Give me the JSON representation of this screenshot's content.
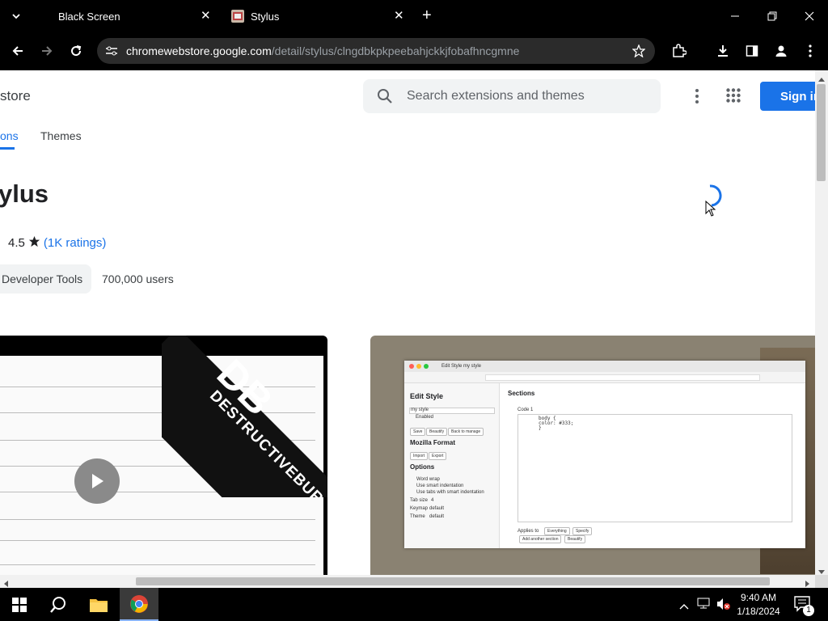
{
  "browser": {
    "tabs": [
      {
        "title": "Black Screen",
        "active": false
      },
      {
        "title": "Stylus",
        "active": true
      }
    ],
    "url_domain": "chromewebstore.google.com",
    "url_path": "/detail/stylus/clngdbkpkpeebahjckkjfobafhncgmne"
  },
  "store": {
    "label": "store",
    "search_placeholder": "Search extensions and themes",
    "sign_in_label": "Sign in",
    "nav_tabs": [
      {
        "label": "ons",
        "active": true
      },
      {
        "label": "Themes",
        "active": false
      }
    ]
  },
  "extension": {
    "title": "ylus",
    "rating": "4.5",
    "ratings_link": "(1K ratings)",
    "category": "Developer Tools",
    "users": "700,000 users"
  },
  "media": {
    "video_logo_text": "DESTRUCTIVEBURN",
    "video_logo_mark": "DB",
    "screenshot": {
      "window_tab": "Edit Style my style",
      "edit_style": "Edit Style",
      "style_name": "my style",
      "enabled_label": "Enabled",
      "buttons": [
        "Save",
        "Beautify",
        "Back to manage"
      ],
      "mozilla_format": "Mozilla Format",
      "import_export": [
        "Import",
        "Export"
      ],
      "options_title": "Options",
      "options": [
        "Word wrap",
        "Use smart indentation",
        "Use tabs with smart indentation"
      ],
      "tab_size_label": "Tab size",
      "tab_size_value": "4",
      "keymap_label": "Keymap",
      "keymap_value": "default",
      "theme_label": "Theme",
      "theme_value": "default",
      "sections_title": "Sections",
      "code_label": "Code 1",
      "code_lines": [
        "body {",
        "  color: #333;",
        "}"
      ],
      "applies_to": "Applies to",
      "applies_buttons": [
        "Everything",
        "Specify"
      ],
      "section_buttons": [
        "Add another section",
        "Beautify"
      ]
    }
  },
  "taskbar": {
    "time": "9:40 AM",
    "date": "1/18/2024",
    "notification_count": "1"
  },
  "colors": {
    "accent": "#1a73e8",
    "chrome_bg": "#000000",
    "omnibox_bg": "#2b2b2b"
  }
}
